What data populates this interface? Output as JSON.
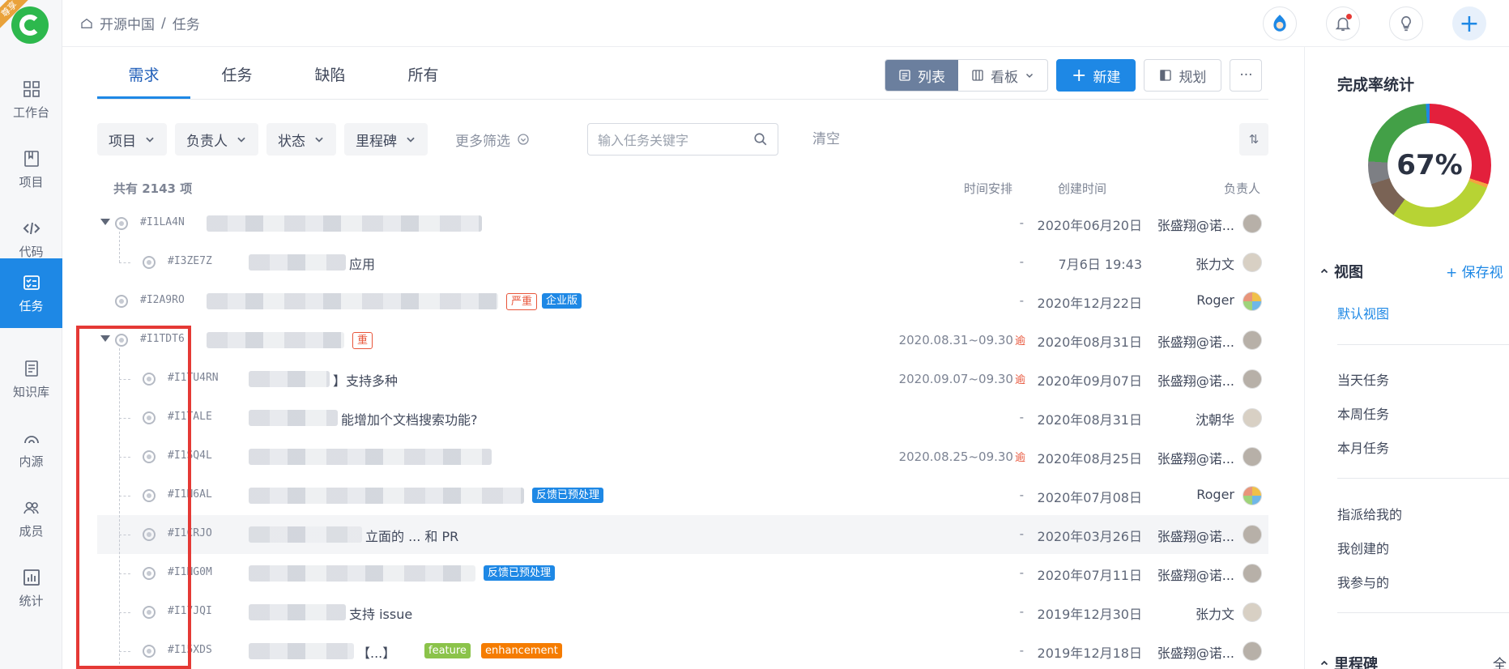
{
  "nav": {
    "ribbon": "尊享",
    "items": [
      {
        "label": "工作台",
        "icon": "grid-icon"
      },
      {
        "label": "项目",
        "icon": "book-icon"
      },
      {
        "label": "代码",
        "icon": "code-icon"
      },
      {
        "label": "任务",
        "icon": "task-icon",
        "active": true
      },
      {
        "label": "知识库",
        "icon": "document-icon"
      },
      {
        "label": "内源",
        "icon": "inner-source-icon"
      },
      {
        "label": "成员",
        "icon": "members-icon"
      },
      {
        "label": "统计",
        "icon": "chart-icon"
      }
    ]
  },
  "header": {
    "breadcrumb": [
      "开源中国",
      "任务"
    ],
    "sep": "/"
  },
  "tabs": [
    "需求",
    "任务",
    "缺陷",
    "所有"
  ],
  "toolbar": {
    "list": "列表",
    "board": "看板",
    "new": "新建",
    "plan": "规划",
    "more": "···"
  },
  "filters": {
    "items": [
      "项目",
      "负责人",
      "状态",
      "里程碑"
    ],
    "more": "更多筛选",
    "search_placeholder": "输入任务关键字",
    "clear": "清空",
    "sort": "⇅"
  },
  "list": {
    "total": "共有 2143 项",
    "col_schedule": "时间安排",
    "col_created": "创建时间",
    "col_owner": "负责人",
    "rows": [
      {
        "id": "#I1LA4N",
        "level": 0,
        "caret": true,
        "text": "",
        "schedule": "-",
        "overdue": "",
        "created": "2020年06月20日",
        "owner": "张盛翔@诺...",
        "tags": []
      },
      {
        "id": "#I3ZE7Z",
        "level": 1,
        "caret": false,
        "text": "应用",
        "schedule": "-",
        "overdue": "",
        "created": "7月6日 19:43",
        "owner": "张力文",
        "tags": []
      },
      {
        "id": "#I2A9RO",
        "level": 0,
        "caret": false,
        "text": "",
        "schedule": "-",
        "overdue": "",
        "created": "2020年12月22日",
        "owner": "Roger",
        "tags": [
          {
            "t": "严重",
            "c": "red"
          },
          {
            "t": "企业版",
            "c": "blue"
          }
        ]
      },
      {
        "id": "#I1TDT6",
        "level": 0,
        "caret": true,
        "text": "",
        "schedule": "2020.08.31~09.30",
        "overdue": "逾",
        "created": "2020年08月31日",
        "owner": "张盛翔@诺...",
        "tags": [
          {
            "t": "重",
            "c": "red"
          }
        ]
      },
      {
        "id": "#I1TU4RN",
        "level": 1,
        "caret": false,
        "text": "】支持多种",
        "schedule": "2020.09.07~09.30",
        "overdue": "逾",
        "created": "2020年09月07日",
        "owner": "张盛翔@诺...",
        "tags": []
      },
      {
        "id": "#I1TALE",
        "level": 1,
        "caret": false,
        "text": "能增加个文档搜索功能?",
        "schedule": "-",
        "overdue": "",
        "created": "2020年08月31日",
        "owner": "沈朝华",
        "tags": []
      },
      {
        "id": "#I1SQ4L",
        "level": 1,
        "caret": false,
        "text": "",
        "schedule": "2020.08.25~09.30",
        "overdue": "逾",
        "created": "2020年08月25日",
        "owner": "张盛翔@诺...",
        "tags": []
      },
      {
        "id": "#I1N6AL",
        "level": 1,
        "caret": false,
        "text": "",
        "schedule": "-",
        "overdue": "",
        "created": "2020年07月08日",
        "owner": "Roger",
        "tags": [
          {
            "t": "反馈已预处理",
            "c": "blue"
          }
        ]
      },
      {
        "id": "#I1CRJO",
        "level": 1,
        "caret": false,
        "text": "立面的 ... 和 PR",
        "schedule": "-",
        "overdue": "",
        "created": "2020年03月26日",
        "owner": "张盛翔@诺...",
        "tags": []
      },
      {
        "id": "#I1NG0M",
        "level": 1,
        "caret": false,
        "text": "",
        "schedule": "-",
        "overdue": "",
        "created": "2020年07月11日",
        "owner": "张盛翔@诺...",
        "tags": [
          {
            "t": "反馈已预处理",
            "c": "blue"
          }
        ]
      },
      {
        "id": "#I17JQI",
        "level": 1,
        "caret": false,
        "text": "支持 issue",
        "schedule": "-",
        "overdue": "",
        "created": "2019年12月30日",
        "owner": "张力文",
        "tags": []
      },
      {
        "id": "#I15XDS",
        "level": 1,
        "caret": false,
        "text": "【...】",
        "schedule": "-",
        "overdue": "",
        "created": "2019年12月18日",
        "owner": "张盛翔@诺...",
        "tags": [
          {
            "t": "feature",
            "c": "green"
          },
          {
            "t": "enhancement",
            "c": "orange"
          }
        ]
      }
    ]
  },
  "right": {
    "title": "完成率统计",
    "rate": "67%",
    "view_title": "视图",
    "save_view": "+ 保存视",
    "default_view": "默认视图",
    "group1": [
      "当天任务",
      "本周任务",
      "本月任务"
    ],
    "group2": [
      "指派给我的",
      "我创建的",
      "我参与的"
    ],
    "milestone_title": "里程碑",
    "milestone_act": "全"
  }
}
